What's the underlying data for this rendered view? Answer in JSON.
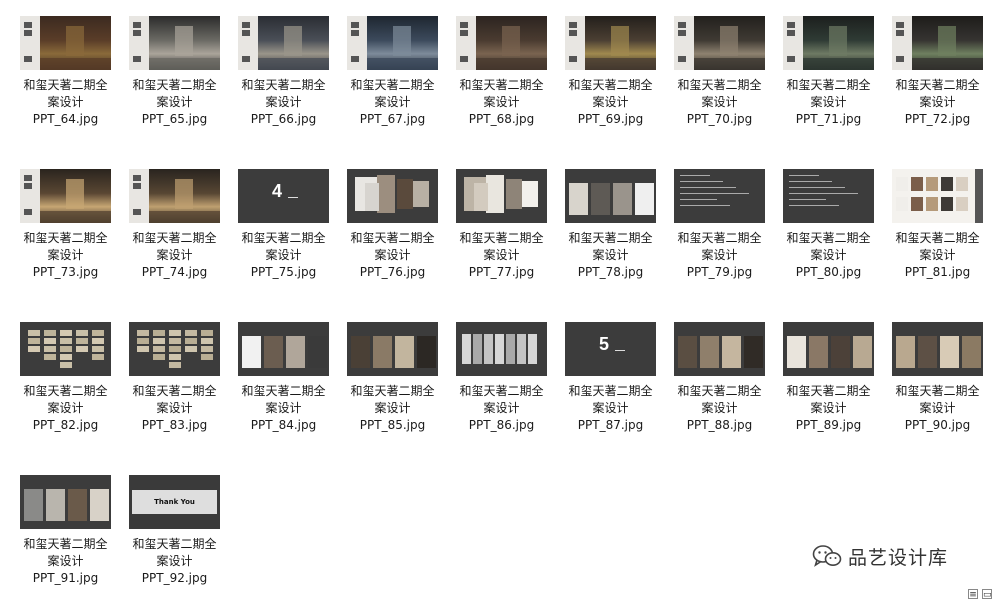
{
  "files": [
    {
      "line1": "和玺天著二期全",
      "line2": "案设计",
      "name": "PPT_64.jpg",
      "kind": "interior",
      "palette": [
        "#3b2a20",
        "#5a3d28",
        "#8a6a3a"
      ]
    },
    {
      "line1": "和玺天著二期全",
      "line2": "案设计",
      "name": "PPT_65.jpg",
      "kind": "interior",
      "palette": [
        "#2b2b2b",
        "#6b6a64",
        "#aaa49a"
      ]
    },
    {
      "line1": "和玺天著二期全",
      "line2": "案设计",
      "name": "PPT_66.jpg",
      "kind": "interior",
      "palette": [
        "#2a2d33",
        "#4a4f57",
        "#9a958a"
      ]
    },
    {
      "line1": "和玺天著二期全",
      "line2": "案设计",
      "name": "PPT_67.jpg",
      "kind": "interior",
      "palette": [
        "#1e2630",
        "#3c4a5c",
        "#7d8b9a"
      ]
    },
    {
      "line1": "和玺天著二期全",
      "line2": "案设计",
      "name": "PPT_68.jpg",
      "kind": "interior",
      "palette": [
        "#2c2420",
        "#4a3b30",
        "#7a6450"
      ]
    },
    {
      "line1": "和玺天著二期全",
      "line2": "案设计",
      "name": "PPT_69.jpg",
      "kind": "interior",
      "palette": [
        "#231f1b",
        "#4b3f33",
        "#a0894f"
      ]
    },
    {
      "line1": "和玺天著二期全",
      "line2": "案设计",
      "name": "PPT_70.jpg",
      "kind": "interior",
      "palette": [
        "#22201d",
        "#3f3a33",
        "#8e8270"
      ]
    },
    {
      "line1": "和玺天著二期全",
      "line2": "案设计",
      "name": "PPT_71.jpg",
      "kind": "interior",
      "palette": [
        "#1c1f1d",
        "#2f3b35",
        "#6e7a64"
      ]
    },
    {
      "line1": "和玺天著二期全",
      "line2": "案设计",
      "name": "PPT_72.jpg",
      "kind": "interior",
      "palette": [
        "#1d1c1a",
        "#363431",
        "#6f8060"
      ]
    },
    {
      "line1": "和玺天著二期全",
      "line2": "案设计",
      "name": "PPT_73.jpg",
      "kind": "interior",
      "palette": [
        "#2a241e",
        "#5a4733",
        "#c7a673"
      ]
    },
    {
      "line1": "和玺天著二期全",
      "line2": "案设计",
      "name": "PPT_74.jpg",
      "kind": "interior",
      "palette": [
        "#29241f",
        "#574633",
        "#bfa070"
      ]
    },
    {
      "line1": "和玺天著二期全",
      "line2": "案设计",
      "name": "PPT_75.jpg",
      "kind": "section",
      "number": "4"
    },
    {
      "line1": "和玺天著二期全",
      "line2": "案设计",
      "name": "PPT_76.jpg",
      "kind": "swatches",
      "palette": [
        "#e8e6e2",
        "#9c8e7f",
        "#5a4a3c",
        "#d7d4cf",
        "#b8b0a4"
      ]
    },
    {
      "line1": "和玺天著二期全",
      "line2": "案设计",
      "name": "PPT_77.jpg",
      "kind": "swatches",
      "palette": [
        "#bdb4a6",
        "#e9e6df",
        "#8e8478",
        "#d3cbbf",
        "#f2f0ec"
      ]
    },
    {
      "line1": "和玺天著二期全",
      "line2": "案设计",
      "name": "PPT_78.jpg",
      "kind": "photos",
      "palette": [
        "#d8d4cc",
        "#5e5a55",
        "#9a948c",
        "#efefef"
      ]
    },
    {
      "line1": "和玺天著二期全",
      "line2": "案设计",
      "name": "PPT_79.jpg",
      "kind": "text"
    },
    {
      "line1": "和玺天著二期全",
      "line2": "案设计",
      "name": "PPT_80.jpg",
      "kind": "text"
    },
    {
      "line1": "和玺天著二期全",
      "line2": "案设计",
      "name": "PPT_81.jpg",
      "kind": "products",
      "palette": [
        "#f0eeea",
        "#7b5e4a",
        "#b59a7a",
        "#3e3a36",
        "#d9cfc2"
      ]
    },
    {
      "line1": "和玺天著二期全",
      "line2": "案设计",
      "name": "PPT_82.jpg",
      "kind": "tiles",
      "palette": [
        "#c9bfa7",
        "#bfb49a",
        "#d4c9b2"
      ]
    },
    {
      "line1": "和玺天著二期全",
      "line2": "案设计",
      "name": "PPT_83.jpg",
      "kind": "tiles",
      "palette": [
        "#c4b9a1",
        "#b9ae94",
        "#cfc5ae"
      ]
    },
    {
      "line1": "和玺天著二期全",
      "line2": "案设计",
      "name": "PPT_84.jpg",
      "kind": "photos",
      "palette": [
        "#f1f1f1",
        "#6b5d50",
        "#b0a69a",
        "#3a3a3a"
      ]
    },
    {
      "line1": "和玺天著二期全",
      "line2": "案设计",
      "name": "PPT_85.jpg",
      "kind": "photos",
      "palette": [
        "#4a4036",
        "#8a7a66",
        "#c2b59e",
        "#2c2824"
      ]
    },
    {
      "line1": "和玺天著二期全",
      "line2": "案设计",
      "name": "PPT_86.jpg",
      "kind": "panels",
      "palette": [
        "#d6d6d6",
        "#a9a9a9",
        "#c4c4c4"
      ]
    },
    {
      "line1": "和玺天著二期全",
      "line2": "案设计",
      "name": "PPT_87.jpg",
      "kind": "section",
      "number": "5"
    },
    {
      "line1": "和玺天著二期全",
      "line2": "案设计",
      "name": "PPT_88.jpg",
      "kind": "photos",
      "palette": [
        "#5a4e42",
        "#8f7f6b",
        "#c5b69f",
        "#302b26"
      ]
    },
    {
      "line1": "和玺天著二期全",
      "line2": "案设计",
      "name": "PPT_89.jpg",
      "kind": "photos",
      "palette": [
        "#e9e4dc",
        "#8a7866",
        "#4c4139",
        "#b8a992"
      ]
    },
    {
      "line1": "和玺天著二期全",
      "line2": "案设计",
      "name": "PPT_90.jpg",
      "kind": "photos",
      "palette": [
        "#b9a88f",
        "#5d5045",
        "#d8cbb6",
        "#8b7a63"
      ]
    },
    {
      "line1": "和玺天著二期全",
      "line2": "案设计",
      "name": "PPT_91.jpg",
      "kind": "photos",
      "palette": [
        "#8a8a88",
        "#b9b5ad",
        "#6a5a4a",
        "#d8d2c8"
      ]
    },
    {
      "line1": "和玺天著二期全",
      "line2": "案设计",
      "name": "PPT_92.jpg",
      "kind": "thanks",
      "card_text": "Thank You"
    }
  ],
  "watermark": {
    "text": "品艺设计库",
    "icon": "wechat-icon"
  },
  "view_controls": {
    "details_icon": "details-view-icon",
    "large_icon": "large-icons-view-icon",
    "details_glyph": "≡",
    "large_glyph": "▭"
  }
}
